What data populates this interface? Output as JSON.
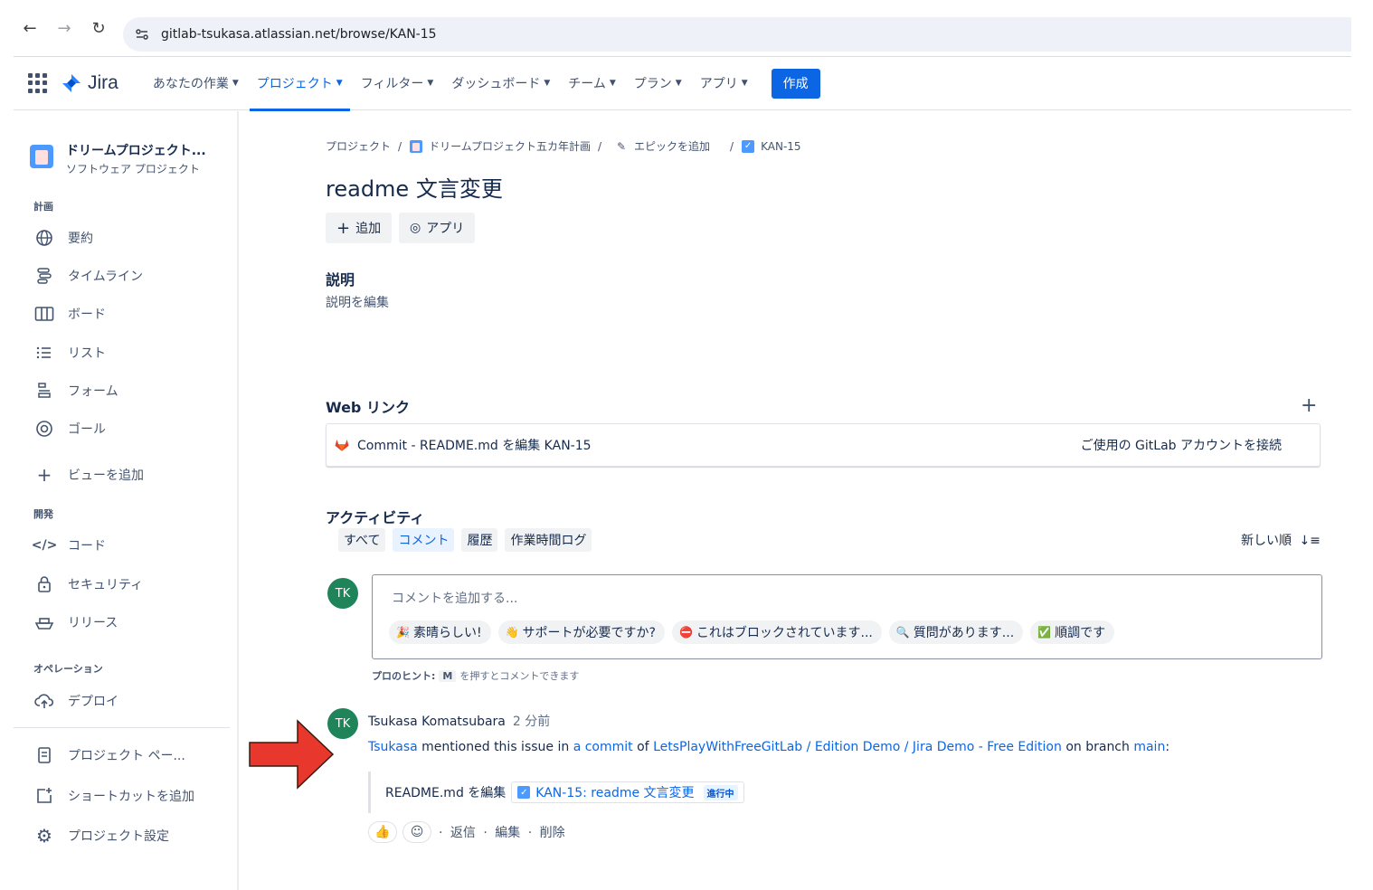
{
  "browser": {
    "url": "gitlab-tsukasa.atlassian.net/browse/KAN-15"
  },
  "topnav": {
    "logo_text": "Jira",
    "items": [
      {
        "label": "あなたの作業"
      },
      {
        "label": "プロジェクト"
      },
      {
        "label": "フィルター"
      },
      {
        "label": "ダッシュボード"
      },
      {
        "label": "チーム"
      },
      {
        "label": "プラン"
      },
      {
        "label": "アプリ"
      }
    ],
    "active_index": 1,
    "create_label": "作成"
  },
  "sidebar": {
    "project_name": "ドリームプロジェクト...",
    "project_type": "ソフトウェア プロジェクト",
    "section_plan": "計画",
    "plan_items": [
      {
        "label": "要約",
        "icon": "globe-icon"
      },
      {
        "label": "タイムライン",
        "icon": "timeline-icon"
      },
      {
        "label": "ボード",
        "icon": "board-icon"
      },
      {
        "label": "リスト",
        "icon": "list-icon"
      },
      {
        "label": "フォーム",
        "icon": "form-icon"
      },
      {
        "label": "ゴール",
        "icon": "goal-icon"
      }
    ],
    "add_view": "ビューを追加",
    "section_dev": "開発",
    "dev_items": [
      {
        "label": "コード",
        "icon": "code-icon"
      },
      {
        "label": "セキュリティ",
        "icon": "lock-icon"
      },
      {
        "label": "リリース",
        "icon": "ship-icon"
      }
    ],
    "section_ops": "オペレーション",
    "ops_items": [
      {
        "label": "デプロイ",
        "icon": "cloud-upload-icon"
      }
    ],
    "footer_items": [
      {
        "label": "プロジェクト ペー...",
        "icon": "page-icon"
      },
      {
        "label": "ショートカットを追加",
        "icon": "add-shortcut-icon"
      },
      {
        "label": "プロジェクト設定",
        "icon": "gear-icon"
      }
    ]
  },
  "main": {
    "breadcrumb": {
      "root": "プロジェクト",
      "project": "ドリームプロジェクト五カ年計画",
      "epic": "エピックを追加",
      "issue": "KAN-15"
    },
    "title": "readme 文言変更",
    "add_button": "追加",
    "apps_button": "アプリ",
    "description_title": "説明",
    "description_placeholder": "説明を編集",
    "weblinks_title": "Web リンク",
    "weblink_text": "Commit - README.md を編集 KAN-15",
    "weblink_connect": "ご使用の GitLab アカウントを接続",
    "activity_title": "アクティビティ",
    "tabs": [
      {
        "label": "すべて"
      },
      {
        "label": "コメント"
      },
      {
        "label": "履歴"
      },
      {
        "label": "作業時間ログ"
      }
    ],
    "active_tab": 1,
    "sort_label": "新しい順",
    "avatar_initials": "TK",
    "comment_placeholder": "コメントを追加する...",
    "quick_replies": [
      {
        "emoji": "🎉",
        "label": "素晴らしい!"
      },
      {
        "emoji": "👋",
        "label": "サポートが必要ですか?"
      },
      {
        "emoji": "⛔",
        "label": "これはブロックされています..."
      },
      {
        "emoji": "🔍",
        "label": "質問があります..."
      },
      {
        "emoji": "✅",
        "label": "順調です"
      }
    ],
    "pro_tip_label": "プロのヒント:",
    "pro_tip_key": "M",
    "pro_tip_text": "を押すとコメントできます",
    "comment": {
      "author": "Tsukasa Komatsubara",
      "time": "2 分前",
      "mention_user": "Tsukasa",
      "mention_text1": "mentioned this issue in",
      "mention_commit": "a commit",
      "mention_of": "of",
      "mention_repo": "LetsPlayWithFreeGitLab / Edition Demo / Jira Demo - Free Edition",
      "mention_branch_text": "on branch",
      "mention_branch": "main",
      "quote_text": "README.md を編集",
      "issue_chip": "KAN-15: readme 文言変更",
      "status": "進行中",
      "reply": "返信",
      "edit": "編集",
      "delete": "削除"
    }
  },
  "colors": {
    "brand_blue": "#0c66e4",
    "avatar_green": "#1f845a",
    "arrow_red": "#e8372c"
  }
}
